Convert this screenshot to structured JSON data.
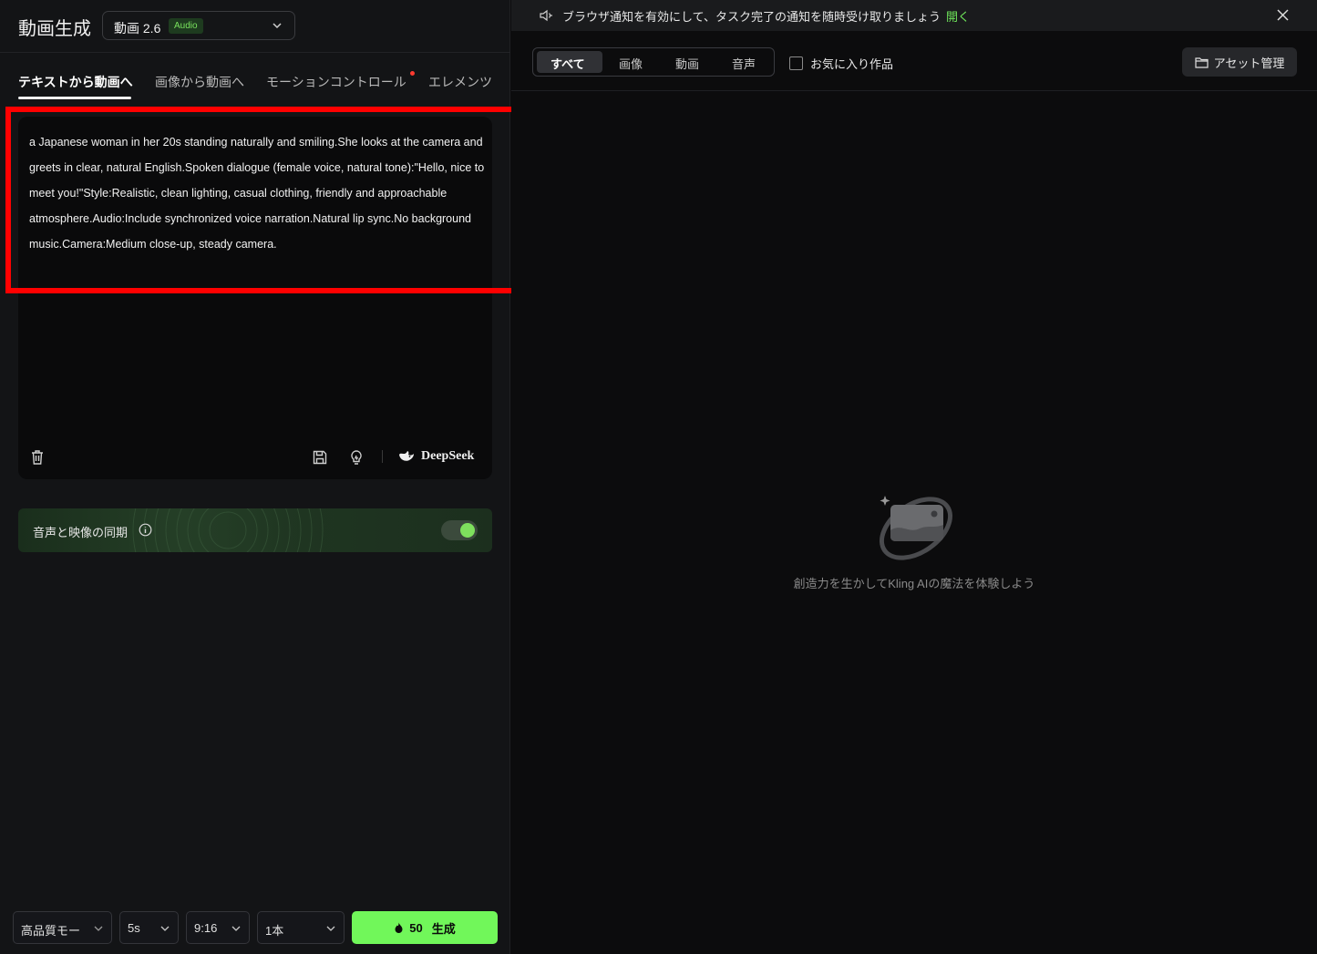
{
  "header": {
    "title": "動画生成",
    "model": {
      "name": "動画 2.6",
      "badge": "Audio"
    }
  },
  "tabs": [
    {
      "label": "テキストから動画へ",
      "active": true
    },
    {
      "label": "画像から動画へ",
      "active": false
    },
    {
      "label": "モーションコントロール",
      "active": false
    },
    {
      "label": "エレメンツ",
      "active": false
    }
  ],
  "prompt": {
    "text": "a Japanese woman in her 20s standing naturally and smiling.She looks at the camera and greets in clear, natural English.Spoken dialogue (female voice, natural tone):\"Hello, nice to meet you!\"Style:Realistic, clean lighting, casual clothing, friendly and approachable atmosphere.Audio:Include synchronized voice narration.Natural lip sync.No background music.Camera:Medium close-up, steady camera.",
    "deepseek_label": "DeepSeek"
  },
  "sync": {
    "label": "音声と映像の同期",
    "enabled": true
  },
  "bottom": {
    "quality": "高品質モー",
    "duration": "5s",
    "ratio": "9:16",
    "count": "1本",
    "credits": "50",
    "generate_label": "生成"
  },
  "notification": {
    "text": "ブラウザ通知を有効にして、タスク完了の通知を随時受け取りましょう",
    "action": "開く"
  },
  "filters": {
    "segments": [
      "すべて",
      "画像",
      "動画",
      "音声"
    ],
    "active_segment": "すべて",
    "favorites_label": "お気に入り作品",
    "asset_button": "アセット管理"
  },
  "empty_state": {
    "text": "創造力を生かしてKling AIの魔法を体験しよう"
  },
  "colors": {
    "accent": "#71f75a",
    "highlight": "#ff0000",
    "notice_link": "#6fe55a"
  }
}
